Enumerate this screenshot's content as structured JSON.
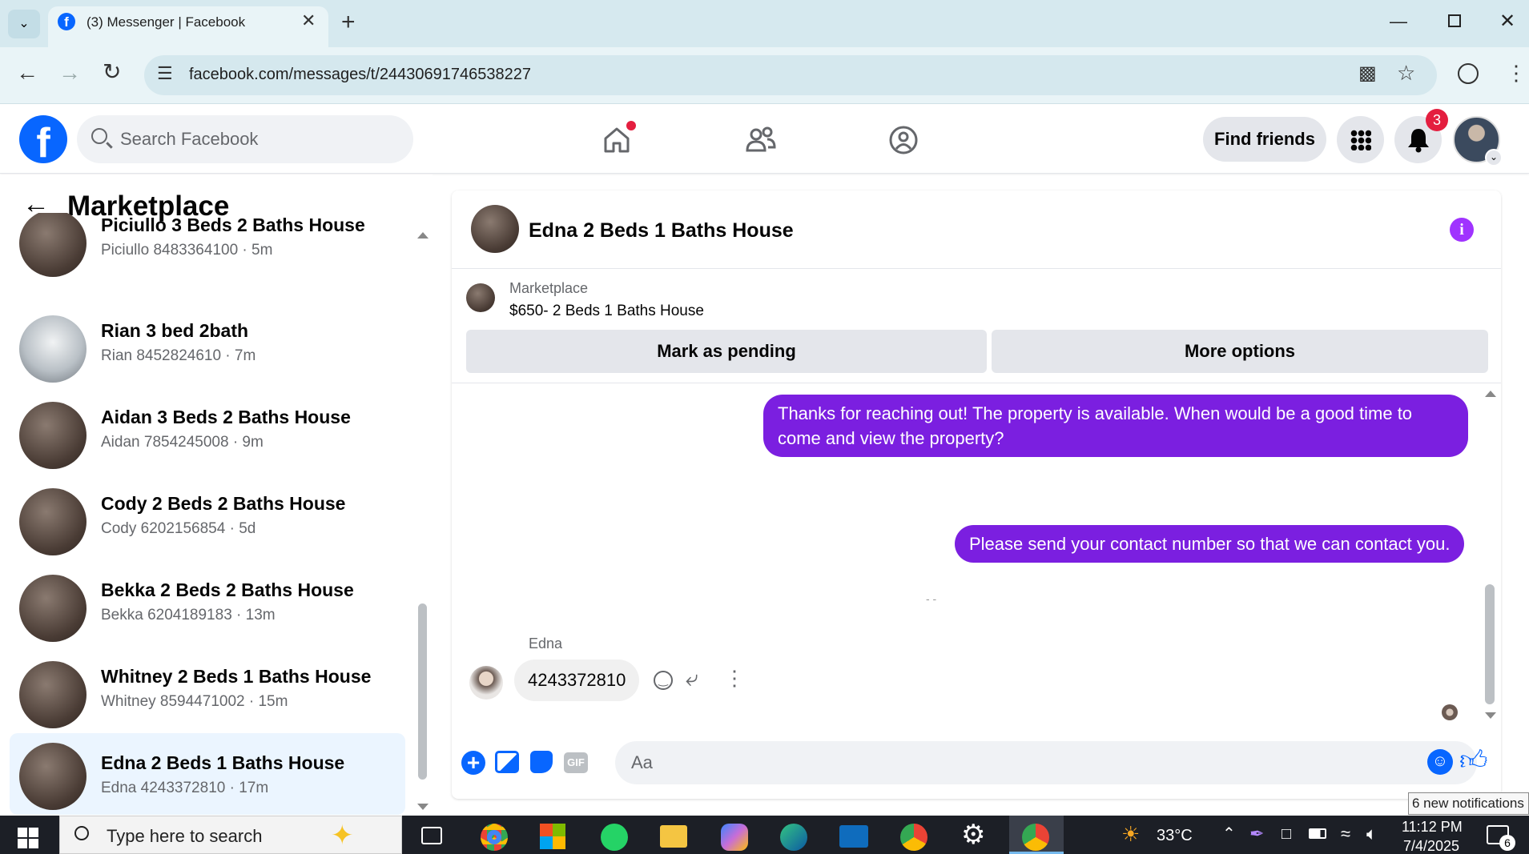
{
  "browser": {
    "tab_title": "(3) Messenger | Facebook",
    "url": "facebook.com/messages/t/24430691746538227"
  },
  "header": {
    "search_placeholder": "Search Facebook",
    "find_friends": "Find friends",
    "notification_count": "3",
    "brand_color": "#0866ff",
    "alert_color": "#e41e3f"
  },
  "sidebar": {
    "title": "Marketplace",
    "conversations": [
      {
        "title": "Piciullo 3 Beds 2 Baths House",
        "subtitle": "Piciullo 8483364100 · 5m"
      },
      {
        "title": "Rian 3 bed 2bath",
        "subtitle": "Rian 8452824610 · 7m"
      },
      {
        "title": "Aidan 3 Beds 2 Baths House",
        "subtitle": "Aidan 7854245008 · 9m"
      },
      {
        "title": "Cody 2 Beds 2 Baths House",
        "subtitle": "Cody 6202156854 · 5d"
      },
      {
        "title": "Bekka 2 Beds 2 Baths House",
        "subtitle": "Bekka 6204189183 · 13m"
      },
      {
        "title": "Whitney 2 Beds 1 Baths House",
        "subtitle": "Whitney 8594471002 · 15m"
      },
      {
        "title": "Edna 2 Beds 1 Baths House",
        "subtitle": "Edna 4243372810 · 17m"
      }
    ]
  },
  "chat": {
    "title": "Edna 2 Beds 1 Baths House",
    "listing_source": "Marketplace",
    "listing_text": "$650- 2 Beds 1 Baths House",
    "mark_pending": "Mark as pending",
    "more_options": "More options",
    "messages": [
      {
        "from": "me",
        "text": "Thanks for reaching out! The property is available. When would be a good time to come and view the property?"
      },
      {
        "from": "me",
        "text": "Please send your contact number so that we can contact you."
      },
      {
        "from": "Edna",
        "text": "4243372810"
      }
    ],
    "sender_name": "Edna",
    "composer_placeholder": "Aa",
    "accent_color": "#7b1fe0"
  },
  "taskbar": {
    "search_placeholder": "Type here to search",
    "temperature": "33°C",
    "time": "11:12 PM",
    "date": "7/4/2025",
    "notif_tooltip": "6 new notifications",
    "notif_count": "6"
  }
}
